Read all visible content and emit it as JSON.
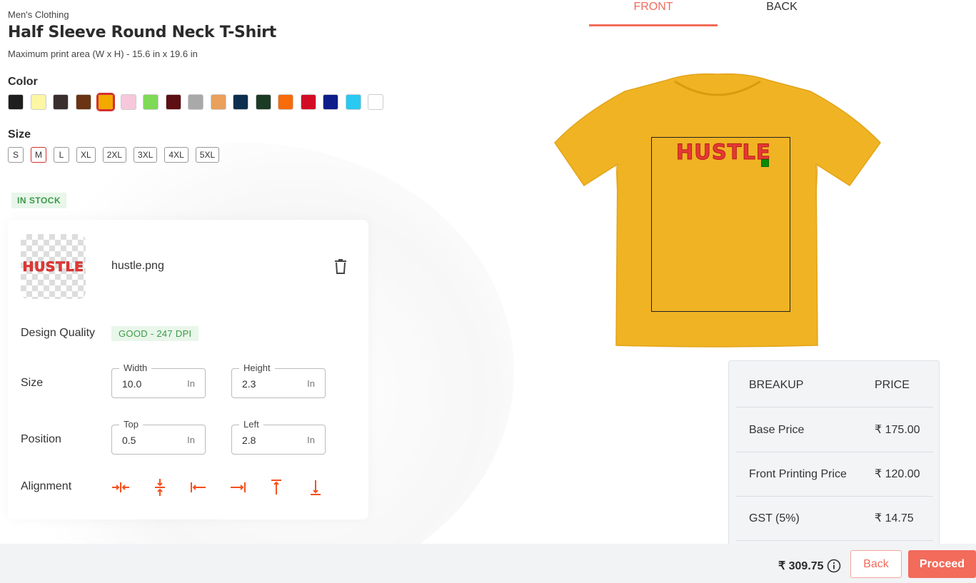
{
  "product": {
    "category": "Men's Clothing",
    "title": "Half Sleeve Round Neck T-Shirt",
    "print_area": "Maximum print area (W x H) - 15.6 in x 19.6 in"
  },
  "color": {
    "label": "Color",
    "swatches": [
      "#1e1e1e",
      "#fdf6a4",
      "#3a2e2e",
      "#6b3413",
      "#f2a900",
      "#f7c8dc",
      "#7ed957",
      "#5e0f14",
      "#a9a9a9",
      "#e9a05b",
      "#0d2f4f",
      "#1c3b25",
      "#f76b0a",
      "#d30c25",
      "#0d1e8a",
      "#29c9f2",
      "#ffffff"
    ],
    "selected_index": 4
  },
  "size": {
    "label": "Size",
    "options": [
      "S",
      "M",
      "L",
      "XL",
      "2XL",
      "3XL",
      "4XL",
      "5XL"
    ],
    "selected": "M"
  },
  "stock_status": "IN STOCK",
  "design": {
    "thumbnail_text": "HUSTLE",
    "filename": "hustle.png",
    "quality_label": "Design Quality",
    "quality_value": "GOOD - 247 DPI",
    "size_label": "Size",
    "width": {
      "legend": "Width",
      "value": "10.0",
      "unit": "In"
    },
    "height": {
      "legend": "Height",
      "value": "2.3",
      "unit": "In"
    },
    "position_label": "Position",
    "top": {
      "legend": "Top",
      "value": "0.5",
      "unit": "In"
    },
    "left": {
      "legend": "Left",
      "value": "2.8",
      "unit": "In"
    },
    "alignment_label": "Alignment",
    "alignment_icons": [
      "center-horizontal-icon",
      "center-vertical-icon",
      "align-left-icon",
      "align-right-icon",
      "align-top-icon",
      "align-bottom-icon"
    ]
  },
  "preview": {
    "tabs": [
      "FRONT",
      "BACK"
    ],
    "active_tab": "FRONT",
    "shirt_color": "#f0b323",
    "design_text": "HUSTLE"
  },
  "breakup": {
    "headers": [
      "BREAKUP",
      "PRICE"
    ],
    "rows": [
      [
        "Base Price",
        "₹ 175.00"
      ],
      [
        "Front Printing Price",
        "₹ 120.00"
      ],
      [
        "GST (5%)",
        "₹ 14.75"
      ]
    ]
  },
  "footer": {
    "total": "₹ 309.75",
    "back_label": "Back",
    "proceed_label": "Proceed"
  },
  "colors": {
    "accent": "#f26b5b",
    "success": "#3a9a48",
    "design_red": "#e53935"
  }
}
